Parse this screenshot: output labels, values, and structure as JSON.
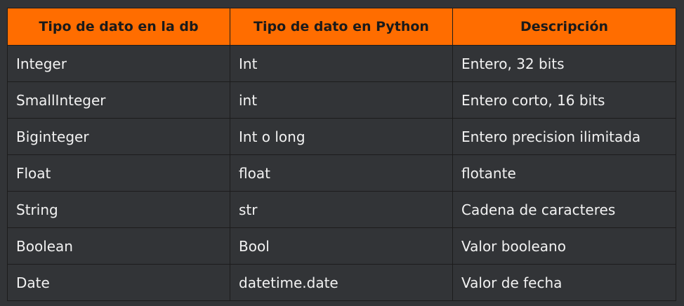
{
  "table": {
    "headers": [
      "Tipo de dato en la db",
      "Tipo de dato en Python",
      "Descripción"
    ],
    "rows": [
      [
        "Integer",
        "Int",
        "Entero, 32 bits"
      ],
      [
        "SmallInteger",
        "int",
        "Entero corto, 16 bits"
      ],
      [
        "Biginteger",
        "Int o long",
        "Entero precision ilimitada"
      ],
      [
        "Float",
        "float",
        "flotante"
      ],
      [
        "String",
        "str",
        "Cadena de caracteres"
      ],
      [
        "Boolean",
        "Bool",
        "Valor booleano"
      ],
      [
        "Date",
        "datetime.date",
        "Valor de fecha"
      ]
    ]
  },
  "colors": {
    "header_bg": "#ff6d00",
    "body_bg": "#323437",
    "text": "#f2f2f2"
  }
}
